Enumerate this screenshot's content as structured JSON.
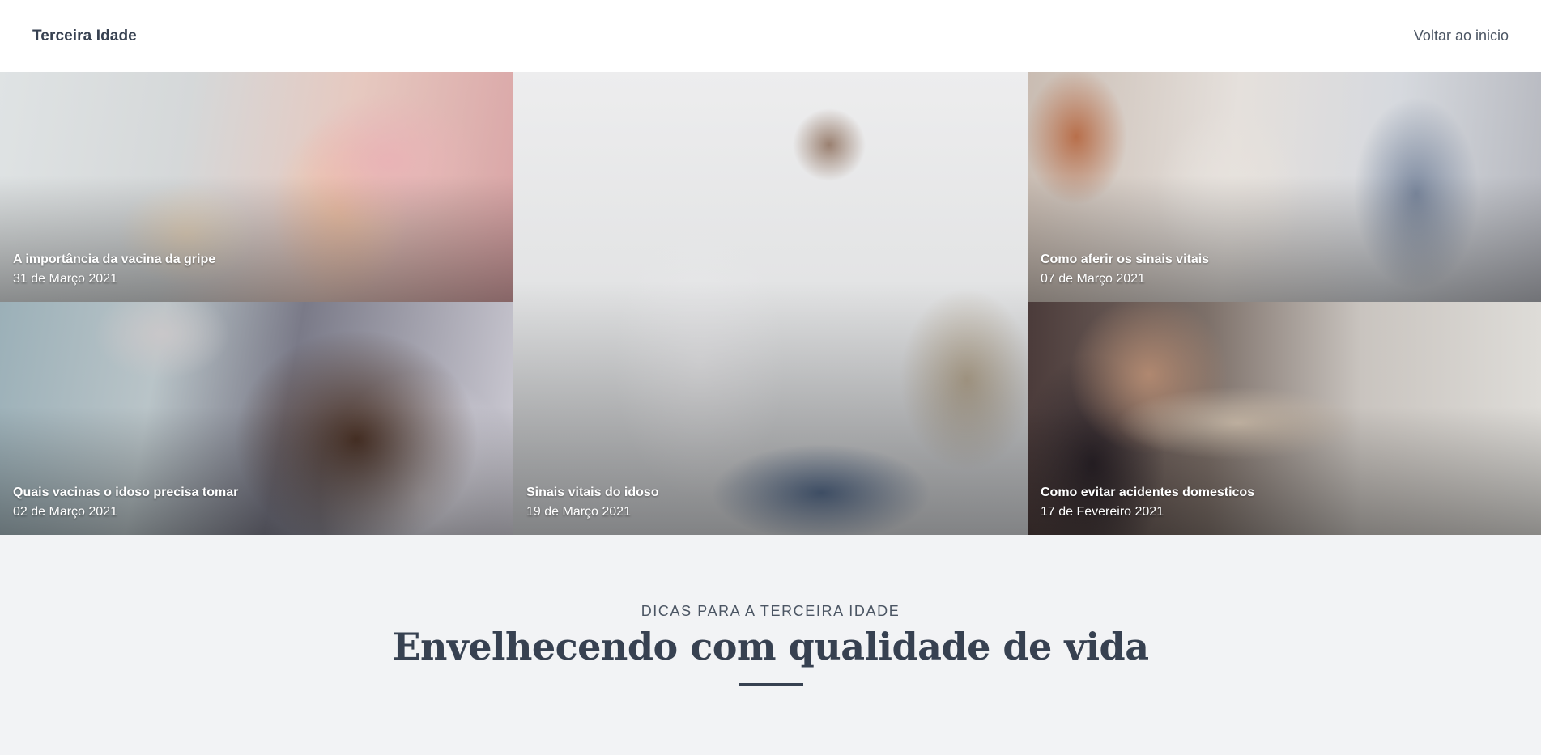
{
  "header": {
    "brand": "Terceira Idade",
    "nav_link": "Voltar ao inicio"
  },
  "articles": [
    {
      "title": "A importância da vacina da gripe",
      "date": "31 de Março 2021"
    },
    {
      "title": "Quais vacinas o idoso precisa tomar",
      "date": "02 de Março 2021"
    },
    {
      "title": "Sinais vitais do idoso",
      "date": "19 de Março 2021"
    },
    {
      "title": "Como aferir os sinais vitais",
      "date": "07 de Março 2021"
    },
    {
      "title": "Como evitar acidentes domesticos",
      "date": "17 de Fevereiro 2021"
    }
  ],
  "intro": {
    "eyebrow": "DICAS PARA A TERCEIRA IDADE",
    "headline": "Envelhecendo com qualidade de vida"
  },
  "colors": {
    "header_bg": "#ffffff",
    "page_bg": "#f2f3f5",
    "text_primary": "#374151",
    "text_muted": "#4b5563",
    "caption_text": "#ffffff"
  }
}
